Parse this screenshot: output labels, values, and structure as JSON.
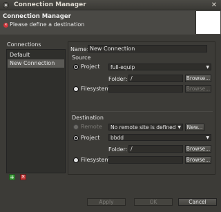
{
  "window": {
    "title": "Connection Manager"
  },
  "banner": {
    "title": "Connection Manager",
    "message": "Please define a destination"
  },
  "connections": {
    "label": "Connections",
    "items": [
      {
        "label": "Default",
        "selected": false
      },
      {
        "label": "New Connection",
        "selected": true
      }
    ]
  },
  "form": {
    "name_label": "Name:",
    "name_value": "New Connection",
    "source": {
      "heading": "Source",
      "project_label": "Project",
      "project_value": "full-equip",
      "folder_label": "Folder:",
      "folder_value": "/",
      "browse_label": "Browse...",
      "filesystem_label": "Filesystem",
      "filesystem_value": "",
      "filesystem_browse_label": "Browse..."
    },
    "destination": {
      "heading": "Destination",
      "remote_label": "Remote",
      "remote_value": "No remote site is defined",
      "new_label": "New...",
      "project_label": "Project",
      "project_value": "bbdd",
      "folder_label": "Folder:",
      "folder_value": "/",
      "browse_label": "Browse...",
      "filesystem_label": "Filesystem",
      "filesystem_value": "",
      "filesystem_browse_label": "Browse..."
    }
  },
  "footer": {
    "apply_label": "Apply",
    "ok_label": "OK",
    "cancel_label": "Cancel"
  }
}
